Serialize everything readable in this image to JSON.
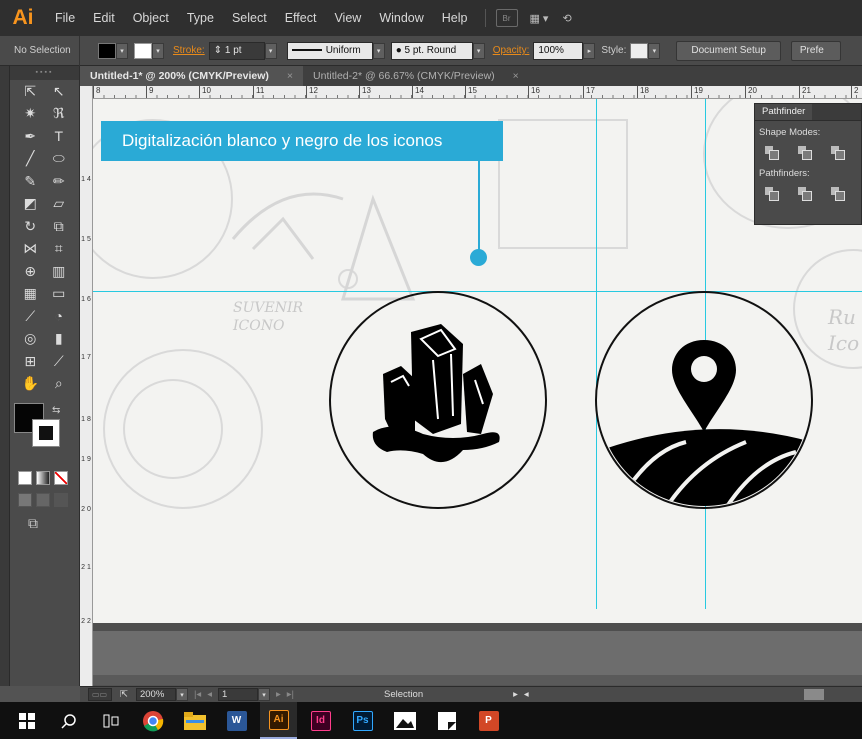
{
  "app": {
    "logo": "Ai"
  },
  "menu": [
    "File",
    "Edit",
    "Object",
    "Type",
    "Select",
    "Effect",
    "View",
    "Window",
    "Help"
  ],
  "menu_extra": {
    "mini_badge": "Br"
  },
  "control": {
    "selection": "No Selection",
    "stroke_label": "Stroke:",
    "stroke_value": "1 pt",
    "profile": "Uniform",
    "brush": "5 pt. Round",
    "opacity_label": "Opacity:",
    "opacity_value": "100%",
    "style_label": "Style:",
    "document_setup": "Document Setup",
    "preferences": "Prefe"
  },
  "tabs": [
    {
      "label": "Untitled-1* @ 200% (CMYK/Preview)",
      "close": "×"
    },
    {
      "label": "Untitled-2* @ 66.67% (CMYK/Preview)",
      "close": "×"
    }
  ],
  "ruler_h": [
    "8",
    "9",
    "10",
    "11",
    "12",
    "13",
    "14",
    "15",
    "16",
    "17",
    "18",
    "19",
    "20",
    "21",
    "2"
  ],
  "ruler_v": [
    "1\n4",
    "1\n5",
    "1\n6",
    "1\n7",
    "1\n8",
    "1\n9",
    "2\n0",
    "2\n1",
    "2\n2"
  ],
  "callout": {
    "text": "Digitalización blanco y negro de los iconos"
  },
  "sketch_notes": {
    "left": "SUVENIR\nICONO",
    "right": "Ru\nIco"
  },
  "pathfinder": {
    "tab": "Pathfinder",
    "shape_modes": "Shape Modes:",
    "pathfinders": "Pathfinders:"
  },
  "status": {
    "zoom": "200%",
    "page": "1",
    "tool": "Selection"
  },
  "taskbar": {
    "word": "W",
    "illustrator": "Ai",
    "indesign": "Id",
    "photoshop": "Ps",
    "powerpoint": "P"
  },
  "colors": {
    "accent": "#2aaad6",
    "guide": "#27c9e0",
    "brand_orange": "#f7941e"
  }
}
